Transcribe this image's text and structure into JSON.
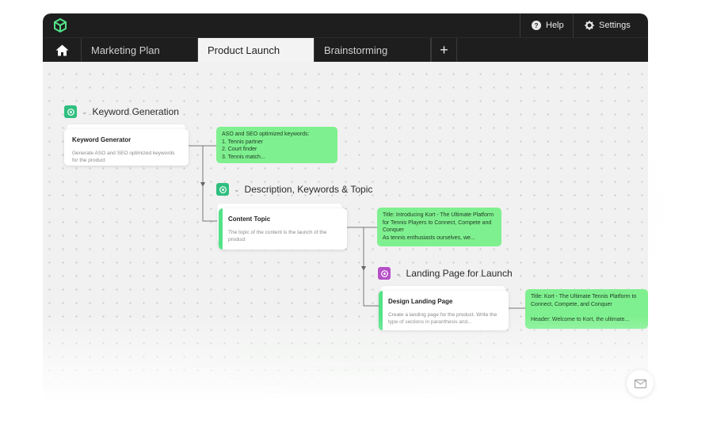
{
  "topbar": {
    "help_label": "Help",
    "settings_label": "Settings"
  },
  "tabs": [
    {
      "label": "Marketing Plan",
      "active": false
    },
    {
      "label": "Product Launch",
      "active": true
    },
    {
      "label": "Brainstorming",
      "active": false
    }
  ],
  "add_tab_label": "+",
  "groups": [
    {
      "title": "Keyword Generation",
      "icon": "chatgpt-icon",
      "icon_color": "#2fbf7f",
      "card": {
        "title": "Keyword Generator",
        "desc": "Generate ASO and SEO optimized keywords for the product"
      },
      "output": "ASO and SEO optimized keywords:\n1. Tennis partner\n2. Court finder\n3. Tennis match..."
    },
    {
      "title": "Description, Keywords & Topic",
      "icon": "chatgpt-icon",
      "icon_color": "#2fbf7f",
      "card": {
        "title": "Content Topic",
        "desc": "The topic of the content is the launch of the product"
      },
      "output": "Title: Introducing Kort - The Ultimate Platform for Tennis Players to Connect, Compete and Conquer\nAs tennis enthusiasts ourselves, we..."
    },
    {
      "title": "Landing Page for Launch",
      "icon": "chatgpt-icon",
      "icon_color": "#b650c7",
      "card": {
        "title": "Design Landing Page",
        "desc": "Create a landing page for the product. Write the type of sections in paranthesis and..."
      },
      "output": "Title: Kort - The Ultimate Tennis Platform to Connect, Compete, and Conquer\n\nHeader: Welcome to Kort, the ultimate..."
    }
  ],
  "colors": {
    "accent_green": "#7ff08f",
    "card_bar_green": "#53e387",
    "topbar": "#1e1e1e"
  }
}
